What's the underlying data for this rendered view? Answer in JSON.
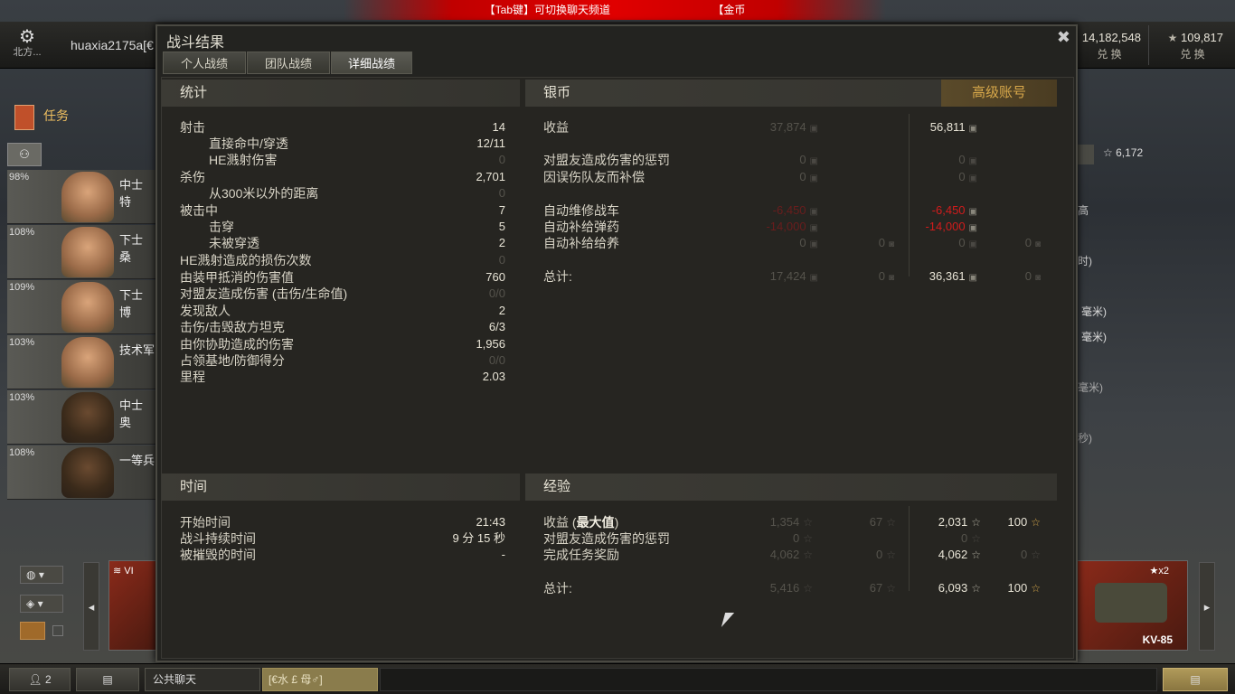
{
  "top_banner": {
    "tab_hint": "【Tab键】可切换聊天频道",
    "gold_hint": "【金币"
  },
  "topbar": {
    "settings_label": "北方...",
    "username": "huaxia2175a[€",
    "credits": {
      "value": "14,182,548",
      "label": "兑 换"
    },
    "gold": {
      "value": "109,817",
      "label": "兑 换"
    },
    "xp_value": "6,172"
  },
  "left": {
    "missions_label": "任务",
    "crew": [
      {
        "pct": "98%",
        "rank": "中士 特"
      },
      {
        "pct": "108%",
        "rank": "下士 桑"
      },
      {
        "pct": "109%",
        "rank": "下士 博"
      },
      {
        "pct": "103%",
        "rank": "技术军"
      },
      {
        "pct": "103%",
        "rank": "中士 奥"
      },
      {
        "pct": "108%",
        "rank": "一等兵"
      }
    ],
    "tank_tier": "VI"
  },
  "right_side_fragments": [
    "高",
    "时)",
    "毫米)",
    "毫米)",
    "毫米)",
    "秒)"
  ],
  "modal": {
    "title": "战斗结果",
    "tabs": [
      {
        "label": "个人战绩",
        "active": false
      },
      {
        "label": "团队战绩",
        "active": false
      },
      {
        "label": "详细战绩",
        "active": true
      }
    ],
    "stats": {
      "header": "统计",
      "rows": [
        {
          "label": "射击",
          "value": "14",
          "indent": false,
          "dim": false
        },
        {
          "label": "直接命中/穿透",
          "value": "12/11",
          "indent": true,
          "dim": false
        },
        {
          "label": "HE溅射伤害",
          "value": "0",
          "indent": true,
          "dim": true
        },
        {
          "label": "杀伤",
          "value": "2,701",
          "indent": false,
          "dim": false
        },
        {
          "label": "从300米以外的距离",
          "value": "0",
          "indent": true,
          "dim": true
        },
        {
          "label": "被击中",
          "value": "7",
          "indent": false,
          "dim": false
        },
        {
          "label": "击穿",
          "value": "5",
          "indent": true,
          "dim": false
        },
        {
          "label": "未被穿透",
          "value": "2",
          "indent": true,
          "dim": false
        },
        {
          "label": "HE溅射造成的损伤次数",
          "value": "0",
          "indent": false,
          "dim": true
        },
        {
          "label": "由装甲抵消的伤害值",
          "value": "760",
          "indent": false,
          "dim": false
        },
        {
          "label": "对盟友造成伤害 (击伤/生命值)",
          "value": "0/0",
          "indent": false,
          "dim": true
        },
        {
          "label": "发现敌人",
          "value": "2",
          "indent": false,
          "dim": false
        },
        {
          "label": "击伤/击毁敌方坦克",
          "value": "6/3",
          "indent": false,
          "dim": false
        },
        {
          "label": "由你协助造成的伤害",
          "value": "1,956",
          "indent": false,
          "dim": false
        },
        {
          "label": "占领基地/防御得分",
          "value": "0/0",
          "indent": false,
          "dim": true
        },
        {
          "label": "里程",
          "value": "2.03",
          "indent": false,
          "dim": false
        }
      ]
    },
    "credits": {
      "header": "银币",
      "premium_label": "高级账号",
      "rows": [
        {
          "label": "收益",
          "base": "37,874",
          "base_gold": "",
          "prem": "56,811",
          "prem_gold": "",
          "style": "normal"
        },
        {
          "label": "对盟友造成伤害的惩罚",
          "base": "0",
          "base_gold": "",
          "prem": "0",
          "prem_gold": "",
          "style": "dim"
        },
        {
          "label": "因误伤队友而补偿",
          "base": "0",
          "base_gold": "",
          "prem": "0",
          "prem_gold": "",
          "style": "dim"
        },
        {
          "label": "自动维修战车",
          "base": "-6,450",
          "base_gold": "",
          "prem": "-6,450",
          "prem_gold": "",
          "style": "red"
        },
        {
          "label": "自动补给弹药",
          "base": "-14,000",
          "base_gold": "",
          "prem": "-14,000",
          "prem_gold": "",
          "style": "red"
        },
        {
          "label": "自动补给给养",
          "base": "0",
          "base_gold": "0",
          "prem": "0",
          "prem_gold": "0",
          "style": "dim"
        },
        {
          "label": "总计:",
          "base": "17,424",
          "base_gold": "0",
          "prem": "36,361",
          "prem_gold": "0",
          "style": "total"
        }
      ]
    },
    "time": {
      "header": "时间",
      "rows": [
        {
          "label": "开始时间",
          "value": "21:43"
        },
        {
          "label": "战斗持续时间",
          "value": "9 分 15 秒"
        },
        {
          "label": "被摧毁的时间",
          "value": "-"
        }
      ]
    },
    "experience": {
      "header": "经验",
      "rows": [
        {
          "label": "收益 (",
          "label_bold": "最大值",
          "label_end": ")",
          "base": "1,354",
          "base_free": "67",
          "prem": "2,031",
          "prem_free": "100",
          "style": "normal"
        },
        {
          "label": "对盟友造成伤害的惩罚",
          "label_bold": "",
          "label_end": "",
          "base": "0",
          "base_free": "",
          "prem": "0",
          "prem_free": "",
          "style": "dim"
        },
        {
          "label": "完成任务奖励",
          "label_bold": "",
          "label_end": "",
          "base": "4,062",
          "base_free": "0",
          "prem": "4,062",
          "prem_free": "0",
          "style": "mission"
        },
        {
          "label": "总计:",
          "label_bold": "",
          "label_end": "",
          "base": "5,416",
          "base_free": "67",
          "prem": "6,093",
          "prem_free": "100",
          "style": "total"
        }
      ]
    }
  },
  "bottombar": {
    "players_count": "2",
    "channel_label": "公共聊天",
    "chat_input_text": "[€水 £ 母♂]"
  },
  "tank": {
    "name": "KV-85",
    "multiplier": "x2"
  }
}
